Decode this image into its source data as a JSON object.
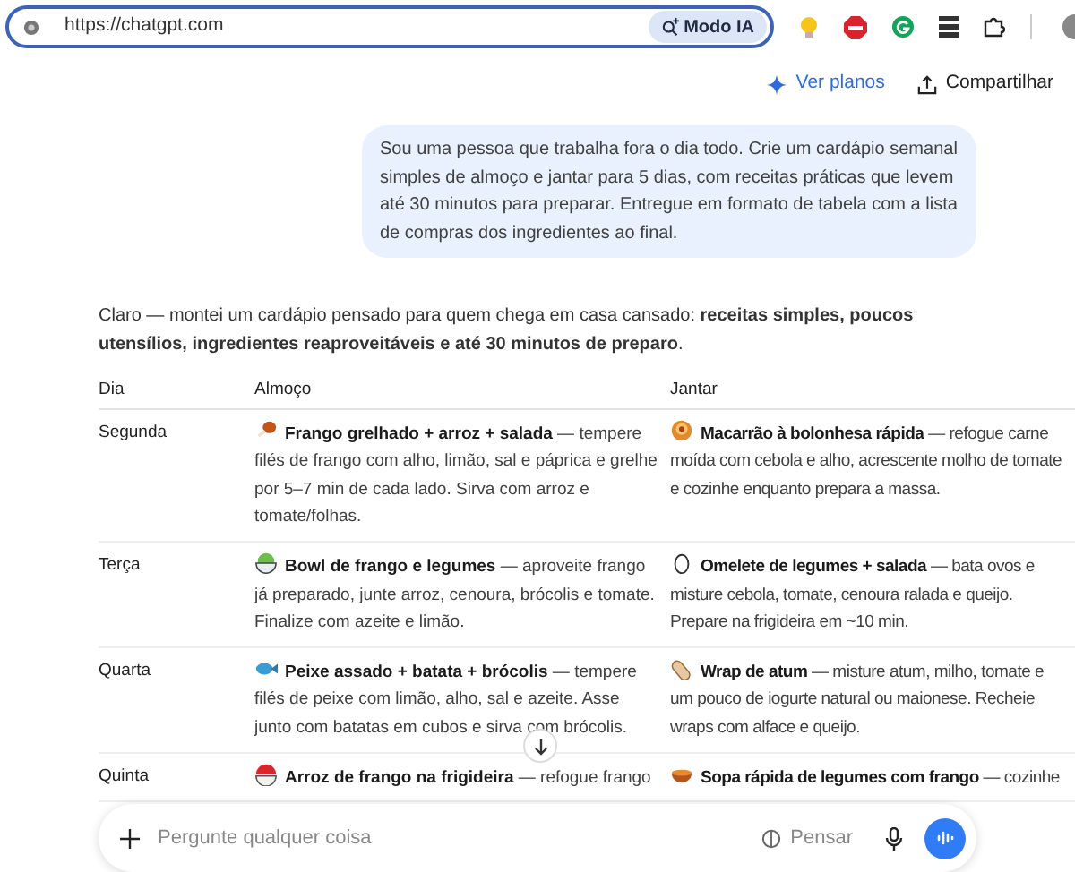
{
  "browser": {
    "url": "https://chatgpt.com",
    "mode_button": "Modo IA"
  },
  "header": {
    "buttons": [
      {
        "label": "Ver planos",
        "kind": "plans"
      },
      {
        "label": "Compartilhar",
        "kind": "share"
      }
    ]
  },
  "user_message": "Sou uma pessoa que trabalha fora o dia todo. Crie um cardápio semanal simples de almoço e jantar para 5 dias, com receitas práticas que levem até 30 minutos para preparar. Entregue em formato de tabela com a lista de compras dos ingredientes ao final.",
  "assistant_intro": "Claro — montei um cardápio pensado para quem chega em casa cansado: **receitas simples, poucos utensílios, ingredientes reaproveitáveis e até 30 minutos de preparo**.",
  "table": {
    "columns": [
      "Dia",
      "Almoço",
      "Jantar"
    ],
    "rows": [
      {
        "day": "Segunda",
        "lunch": {
          "title": "Frango grelhado + arroz + salada",
          "description": " — tempere filés de frango com alho, limão, sal e páprica e grelhe por 5–7 min de cada lado. Sirva com arroz e tomate/folhas."
        },
        "dinner": {
          "title": "Macarrão à bolonhesa rápida",
          "description": " — refogue carne moída com cebola e alho, acrescente molho de tomate e cozinhe enquanto prepara a massa."
        }
      },
      {
        "day": "Terça",
        "lunch": {
          "title": "Bowl de frango e legumes",
          "description": " — aproveite frango já preparado, junte arroz, cenoura, brócolis e tomate. Finalize com azeite e limão."
        },
        "dinner": {
          "title": "Omelete de legumes + salada",
          "description": " — bata ovos e misture cebola, tomate, cenoura ralada e queijo. Prepare na frigideira em ~10 min."
        }
      },
      {
        "day": "Quarta",
        "lunch": {
          "title": "Peixe assado + batata + brócolis",
          "description": " — tempere filés de peixe com limão, alho, sal e azeite. Asse junto com batatas em cubos e sirva com brócolis."
        },
        "dinner": {
          "title": "Wrap de atum",
          "description": " — misture atum, milho, tomate e um pouco de iogurte natural ou maionese. Recheie wraps com alface e queijo."
        }
      },
      {
        "day": "Quinta",
        "lunch": {
          "title": "Arroz de frango na frigideira",
          "description": " — refogue frango"
        },
        "dinner": {
          "title": "Sopa rápida de legumes com frango",
          "description": " — cozinhe"
        }
      }
    ]
  },
  "composer": {
    "placeholder": "Pergunte qualquer coisa",
    "think_button": "Pensar"
  }
}
